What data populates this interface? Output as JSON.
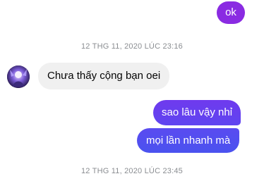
{
  "colors": {
    "outgoing_top": "#8a2be2",
    "outgoing_mid": "#6a3cf0",
    "outgoing_bottom": "#4a52ef",
    "incoming": "#f0f0f0",
    "timestamp": "#8a8d91"
  },
  "messages": [
    {
      "type": "outgoing",
      "text": "ok"
    },
    {
      "type": "timestamp",
      "text": "12 THG 11, 2020 LÚC 23:16"
    },
    {
      "type": "incoming",
      "text": "Chưa thấy cộng bạn oei",
      "avatar_icon": "contact-avatar"
    },
    {
      "type": "outgoing",
      "text": "sao lâu vậy nhỉ"
    },
    {
      "type": "outgoing",
      "text": "mọi lần nhanh mà"
    },
    {
      "type": "timestamp",
      "text": "12 THG 11, 2020 LÚC 23:45"
    }
  ]
}
